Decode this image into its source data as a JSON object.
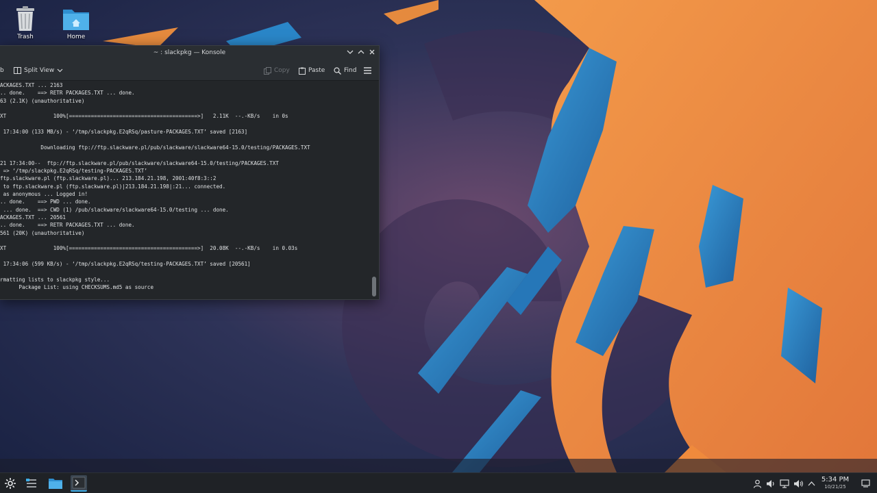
{
  "desktop": {
    "icons": [
      {
        "label": "Trash",
        "icon": "trash-icon"
      },
      {
        "label": "Home",
        "icon": "home-folder-icon"
      }
    ]
  },
  "window": {
    "title": "~ : slackpkg — Konsole",
    "toolbar": {
      "tab_partial": "b",
      "split_view": "Split View",
      "copy": "Copy",
      "paste": "Paste",
      "find": "Find"
    },
    "terminal_lines": [
      "ACKAGES.TXT ... 2163",
      ".. done.    ==> RETR PACKAGES.TXT ... done.",
      "63 (2.1K) (unauthoritative)",
      "",
      "XT               100%[=========================================>]   2.11K  --.-KB/s    in 0s",
      "",
      " 17:34:00 (133 MB/s) - ‘/tmp/slackpkg.E2qRSq/pasture-PACKAGES.TXT’ saved [2163]",
      "",
      "             Downloading ftp://ftp.slackware.pl/pub/slackware/slackware64-15.0/testing/PACKAGES.TXT",
      "",
      "21 17:34:00--  ftp://ftp.slackware.pl/pub/slackware/slackware64-15.0/testing/PACKAGES.TXT",
      " => ‘/tmp/slackpkg.E2qRSq/testing-PACKAGES.TXT’",
      "ftp.slackware.pl (ftp.slackware.pl)... 213.184.21.198, 2001:40f8:3::2",
      " to ftp.slackware.pl (ftp.slackware.pl)|213.184.21.198|:21... connected.",
      " as anonymous ... Logged in!",
      ".. done.    ==> PWD ... done.",
      " ... done.  ==> CWD (1) /pub/slackware/slackware64-15.0/testing ... done.",
      "ACKAGES.TXT ... 20561",
      ".. done.    ==> RETR PACKAGES.TXT ... done.",
      "561 (20K) (unauthoritative)",
      "",
      "XT               100%[=========================================>]  20.08K  --.-KB/s    in 0.03s",
      "",
      " 17:34:06 (599 KB/s) - ‘/tmp/slackpkg.E2qRSq/testing-PACKAGES.TXT’ saved [20561]",
      "",
      "rmatting lists to slackpkg style...",
      "      Package List: using CHECKSUMS.md5 as source"
    ]
  },
  "taskbar": {
    "items": [
      {
        "icon": "application-launcher-icon"
      },
      {
        "icon": "pager-icon"
      },
      {
        "icon": "file-manager-icon"
      },
      {
        "icon": "konsole-task-icon",
        "active": true
      }
    ],
    "tray": [
      {
        "icon": "user-icon"
      },
      {
        "icon": "audio-icon"
      },
      {
        "icon": "display-icon"
      },
      {
        "icon": "volume-icon"
      },
      {
        "icon": "expand-tray-icon"
      }
    ],
    "clock": {
      "time": "5:34 PM",
      "date": "10/21/25"
    }
  },
  "colors": {
    "accent": "#3daee9",
    "wallpaper_orange": "#ef8a3c",
    "wallpaper_blue": "#2b86c8",
    "wallpaper_dark": "#1c2744"
  }
}
